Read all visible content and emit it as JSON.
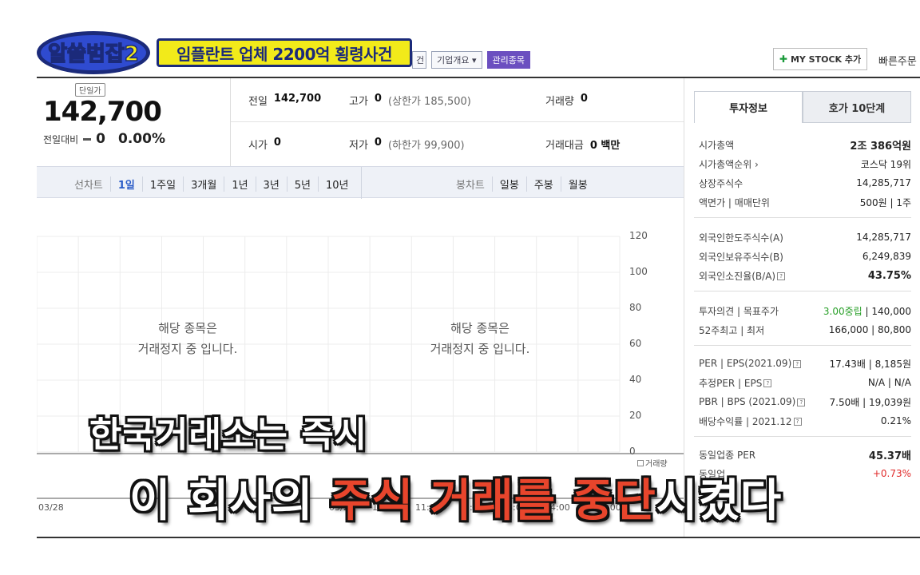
{
  "overlay": {
    "show_logo": "알쓸범잡2",
    "title": "임플란트 업체 2200억 횡령사건",
    "subtitle_line1": "한국거래소는 즉시",
    "subtitle_line2_pre": "이 회사의 ",
    "subtitle_line2_highlight": "주식 거래를 중단",
    "subtitle_line2_post": "시켰다"
  },
  "toolbar": {
    "tag_partial": "건",
    "tag_company": "기업개요 ▾",
    "tag_managed": "관리종목",
    "mystock_label": "MY STOCK 추가",
    "quick_order": "빠른주문"
  },
  "price": {
    "badge": "단일가",
    "current": "142,700",
    "change_label": "전일대비",
    "change_value": "0",
    "change_pct": "0.00%"
  },
  "quote": {
    "prev_label": "전일",
    "prev_value": "142,700",
    "high_label": "고가",
    "high_value": "0",
    "high_sub": "(상한가 185,500)",
    "volume_label": "거래량",
    "volume_value": "0",
    "open_label": "시가",
    "open_value": "0",
    "low_label": "저가",
    "low_value": "0",
    "low_sub": "(하한가 99,900)",
    "amount_label": "거래대금",
    "amount_value": "0 백만"
  },
  "chart_tabs": {
    "line_label": "선차트",
    "line_periods": [
      "1일",
      "1주일",
      "3개월",
      "1년",
      "3년",
      "5년",
      "10년"
    ],
    "candle_label": "봉차트",
    "candle_periods": [
      "일봉",
      "주봉",
      "월봉"
    ]
  },
  "chart": {
    "halt_line1": "해당 종목은",
    "halt_line2": "거래정지 중 입니다.",
    "y_ticks": [
      "120",
      "100",
      "80",
      "60",
      "40",
      "20",
      "0"
    ],
    "x_ticks": [
      "03/28",
      "03/29",
      "10:00",
      "11:00",
      "12:00",
      "13:00",
      "14:00",
      "15:00"
    ],
    "volume_legend": "거래량"
  },
  "invest": {
    "tab_info": "투자정보",
    "tab_quote10": "호가 10단계",
    "market_cap_label": "시가총액",
    "market_cap_value": "2조 386억원",
    "market_cap_rank_label": "시가총액순위 ›",
    "market_cap_rank_value": "코스닥 19위",
    "listed_shares_label": "상장주식수",
    "listed_shares_value": "14,285,717",
    "par_label": "액면가 | 매매단위",
    "par_value": "500원 | 1주",
    "foreign_limit_label": "외국인한도주식수(A)",
    "foreign_limit_value": "14,285,717",
    "foreign_hold_label": "외국인보유주식수(B)",
    "foreign_hold_value": "6,249,839",
    "foreign_ratio_label": "외국인소진율(B/A)",
    "foreign_ratio_value": "43.75%",
    "opinion_label": "투자의견 | 목표주가",
    "opinion_value": "3.00중립",
    "target_value": "140,000",
    "w52_label": "52주최고 | 최저",
    "w52_value": "166,000 | 80,800",
    "per_label": "PER | EPS(2021.09)",
    "per_value": "17.43배 | 8,185원",
    "est_per_label": "추정PER | EPS",
    "est_per_value": "N/A | N/A",
    "pbr_label": "PBR | BPS (2021.09)",
    "pbr_value": "7.50배 | 19,039원",
    "dividend_label": "배당수익률 | 2021.12",
    "dividend_value": "0.21%",
    "sector_per_label": "동일업종 PER",
    "sector_per_value": "45.37배",
    "sector_rate_label": "동일업",
    "sector_rate_value": "+0.73%"
  },
  "colors": {
    "accent_blue": "#2a5cc8",
    "title_yellow": "#f2ea1a",
    "managed_purple": "#6b4fc0",
    "highlight_red": "#e8452c"
  }
}
